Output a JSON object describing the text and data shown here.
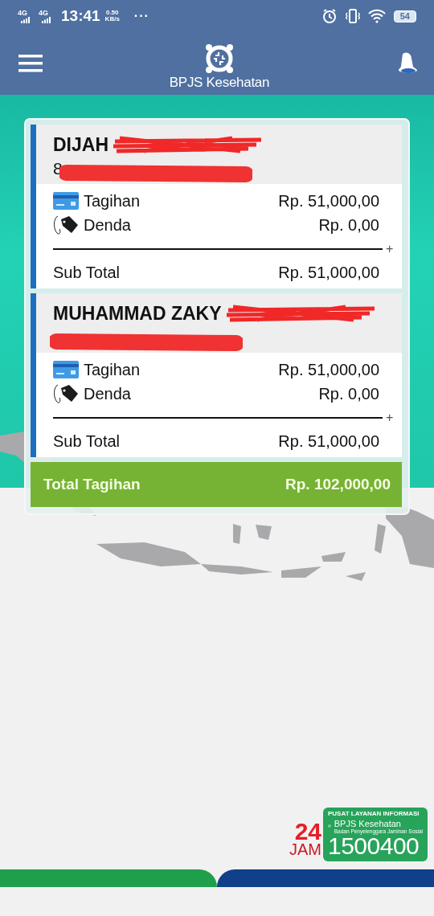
{
  "status_bar": {
    "networks": [
      "4G",
      "4G"
    ],
    "time": "13:41",
    "speed": "0.50",
    "speed_unit": "KB/s",
    "more": "···",
    "battery": "54"
  },
  "header": {
    "brand": "BPJS Kesehatan"
  },
  "members": [
    {
      "name": "DIJAH",
      "name_redacted": true,
      "number": "8",
      "number_redacted": true,
      "items": [
        {
          "kind": "bill",
          "label": "Tagihan",
          "amount": "Rp. 51,000,00"
        },
        {
          "kind": "fine",
          "label": "Denda",
          "amount": "Rp. 0,00"
        }
      ],
      "sum_sign": "+",
      "subtotal_label": "Sub Total",
      "subtotal": "Rp. 51,000,00"
    },
    {
      "name": "MUHAMMAD ZAKY",
      "name_redacted": true,
      "number_redacted": true,
      "items": [
        {
          "kind": "bill",
          "label": "Tagihan",
          "amount": "Rp. 51,000,00"
        },
        {
          "kind": "fine",
          "label": "Denda",
          "amount": "Rp. 0,00"
        }
      ],
      "sum_sign": "+",
      "subtotal_label": "Sub Total",
      "subtotal": "Rp. 51,000,00"
    }
  ],
  "total": {
    "label": "Total Tagihan",
    "amount": "Rp. 102,000,00"
  },
  "hotline": {
    "hours": "24",
    "hours_unit": "JAM",
    "title": "PUSAT LAYANAN INFORMASI",
    "brand": "BPJS Kesehatan",
    "subtitle": "Badan Penyelenggara Jaminan Sosial",
    "number": "1500400"
  }
}
